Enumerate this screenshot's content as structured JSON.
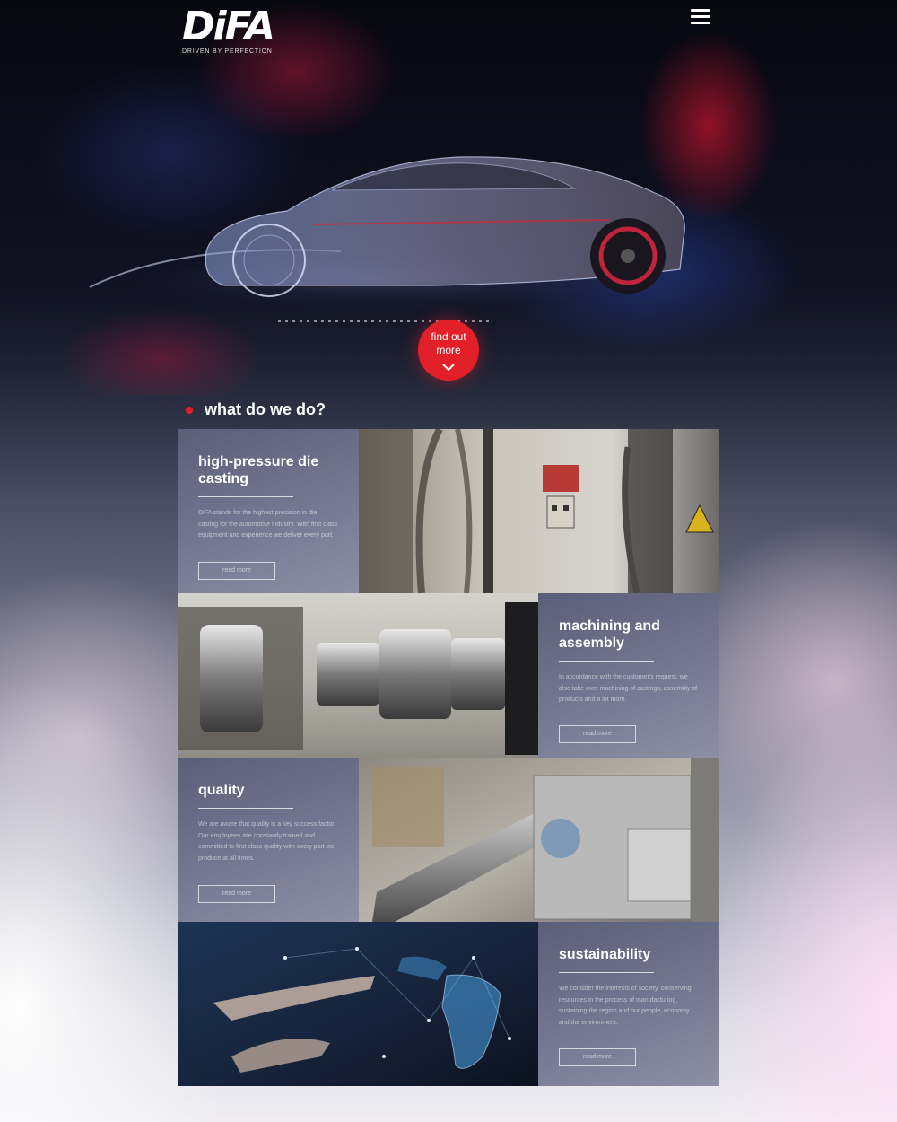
{
  "header": {
    "logo_text": "DiFA",
    "logo_tagline": "DRIVEN BY PERFECTION",
    "menu_icon": "hamburger-menu-icon"
  },
  "hero": {
    "cta_label": "find out more",
    "cta_icon": "chevron-down-icon"
  },
  "section": {
    "title": "what do we do?"
  },
  "services": [
    {
      "title": "high-pressure die casting",
      "text": "DiFA stands for the highest precision in die casting for the automotive industry. With first class equipment and experience we deliver every part.",
      "button": "read more",
      "image": "die-casting-machine-photo"
    },
    {
      "title": "machining and assembly",
      "text": "In accordance with the customer's request, we also take over machining of castings, assembly of products and a lot more.",
      "button": "read more",
      "image": "machined-part-photo"
    },
    {
      "title": "quality",
      "text": "We are aware that quality is a key success factor. Our employees are constantly trained and committed to first class quality with every part we produce at all times.",
      "button": "read more",
      "image": "quality-inspection-photo"
    },
    {
      "title": "sustainability",
      "text": "We consider the interests of society, conserving resources in the process of manufacturing, sustaining the region and our people, economy and the environment.",
      "button": "read more",
      "image": "digital-globe-hand-photo"
    }
  ],
  "colors": {
    "accent": "#e3202a",
    "panel": "#6f7289"
  }
}
